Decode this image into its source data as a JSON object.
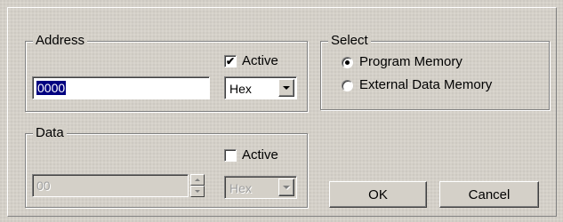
{
  "address": {
    "legend": "Address",
    "active_label": "Active",
    "active_checked": true,
    "value": "0000",
    "format": "Hex"
  },
  "data": {
    "legend": "Data",
    "active_label": "Active",
    "active_checked": false,
    "value": "00",
    "format": "Hex",
    "enabled": false
  },
  "select": {
    "legend": "Select",
    "options": [
      {
        "label": "Program Memory",
        "selected": true
      },
      {
        "label": "External Data Memory",
        "selected": false
      }
    ]
  },
  "buttons": {
    "ok_label": "OK",
    "cancel_label": "Cancel"
  },
  "icons": {
    "check": "✔",
    "dropdown": "chevron-down-icon",
    "spin_up": "spin-up-icon",
    "spin_down": "spin-down-icon"
  }
}
